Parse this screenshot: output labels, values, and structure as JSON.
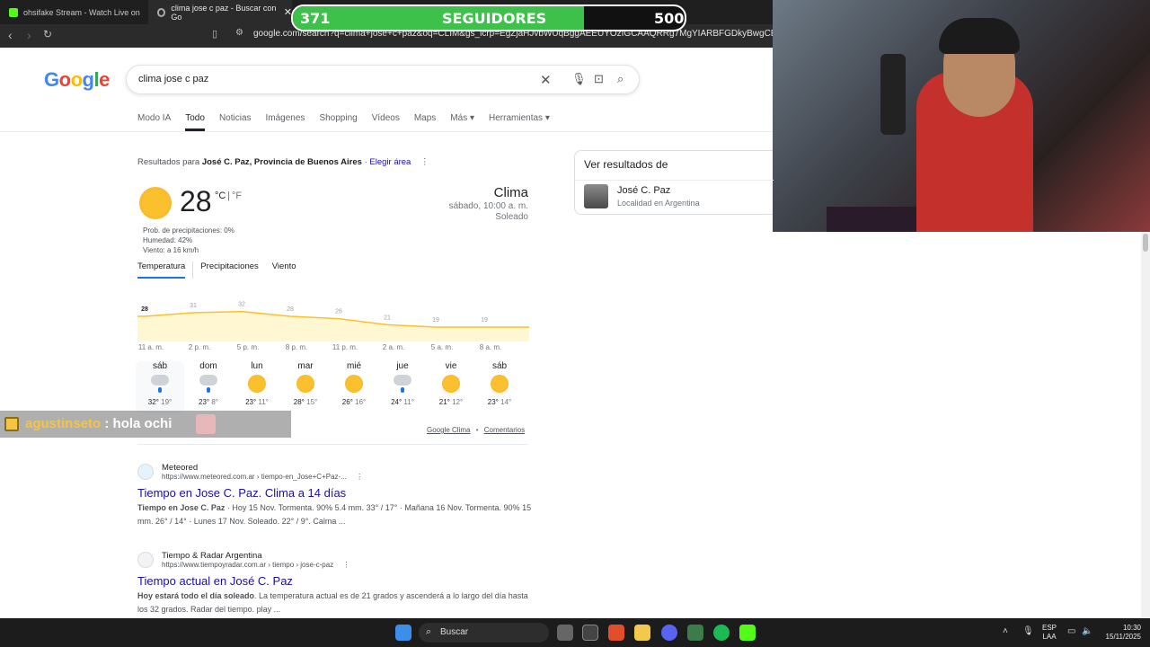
{
  "browser": {
    "tabs": [
      {
        "label": "ohsifake Stream - Watch Live on",
        "active": false
      },
      {
        "label": "clima jose c paz - Buscar con Go",
        "active": true
      }
    ],
    "url": "google.com/search?q=clima+jose+c+paz&oq=CLIM&gs_lcrp=EgZjaHJvbWUqBggAEEUYOzIGCAAQRRg7MgYIARBFGDkyBwgCEAAYjwIyBw"
  },
  "followers": {
    "current": "371",
    "label": "SEGUIDORES",
    "goal": "500",
    "progress": 0.742
  },
  "google": {
    "logo": "Google",
    "search_value": "clima jose c paz",
    "tabs": [
      "Modo IA",
      "Todo",
      "Noticias",
      "Imágenes",
      "Shopping",
      "Vídeos",
      "Maps",
      "Más",
      "Herramientas"
    ],
    "results_for_prefix": "Resultados para",
    "results_for_place": "José C. Paz, Provincia de Buenos Aires",
    "choose_area": "Elegir área"
  },
  "weather": {
    "temp": "28",
    "unit_c": "°C",
    "unit_sep": "|",
    "unit_f": "°F",
    "precip": "Prob. de precipitaciones: 0%",
    "humidity": "Humedad: 42%",
    "wind": "Viento: a 16 km/h",
    "title": "Clima",
    "datetime": "sábado, 10:00 a. m.",
    "condition": "Soleado",
    "subtabs": [
      "Temperatura",
      "Precipitaciones",
      "Viento"
    ],
    "hourly_values": [
      "28",
      "31",
      "32",
      "28",
      "26",
      "21",
      "19",
      "19"
    ],
    "hourly_times": [
      "11 a. m.",
      "2 p. m.",
      "5 p. m.",
      "8 p. m.",
      "11 p. m.",
      "2 a. m.",
      "5 a. m.",
      "8 a. m."
    ],
    "days": [
      {
        "day": "sáb",
        "hi": "32°",
        "lo": "19°",
        "icon": "rain-cloud"
      },
      {
        "day": "dom",
        "hi": "23°",
        "lo": "8°",
        "icon": "rain-cloud"
      },
      {
        "day": "lun",
        "hi": "23°",
        "lo": "11°",
        "icon": "sun"
      },
      {
        "day": "mar",
        "hi": "28°",
        "lo": "15°",
        "icon": "sun"
      },
      {
        "day": "mié",
        "hi": "26°",
        "lo": "16°",
        "icon": "sun"
      },
      {
        "day": "jue",
        "hi": "24°",
        "lo": "11°",
        "icon": "heavy-rain"
      },
      {
        "day": "vie",
        "hi": "21°",
        "lo": "12°",
        "icon": "partly-cloudy"
      },
      {
        "day": "sáb",
        "hi": "23°",
        "lo": "14°",
        "icon": "partly-cloudy"
      }
    ],
    "footer_link1": "Google Clima",
    "footer_sep": "•",
    "footer_link2": "Comentarios"
  },
  "side_panel": {
    "title": "Ver resultados de",
    "name": "José C. Paz",
    "sub": "Localidad en Argentina"
  },
  "results": [
    {
      "site": "Meteored",
      "url": "https://www.meteored.com.ar › tiempo-en_Jose+C+Paz-...",
      "title": "Tiempo en Jose C. Paz. Clima a 14 días",
      "snippet_bold": "Tiempo en Jose C. Paz",
      "snippet": " · Hoy 15 Nov. Tormenta. 90% 5.4 mm. 33° / 17° · Mañana 16 Nov. Tormenta. 90% 15 mm. 26° / 14° · Lunes 17 Nov. Soleado. 22° / 9°. Calma ..."
    },
    {
      "site": "Tiempo & Radar Argentina",
      "url": "https://www.tiempoyradar.com.ar › tiempo › jose-c-paz",
      "title": "Tiempo actual en José C. Paz",
      "snippet_bold": "Hoy estará todo el día soleado",
      "snippet": ". La temperatura actual es de 21 grados y ascenderá a lo largo del día hasta los 32 grados. Radar del tiempo. play ..."
    }
  ],
  "chat": {
    "user": "agustinseto",
    "sep": " : ",
    "message": "hola ochi"
  },
  "taskbar": {
    "search": "Buscar",
    "lang1": "ESP",
    "lang2": "LAA",
    "time": "10:30",
    "date": "15/11/2025"
  }
}
